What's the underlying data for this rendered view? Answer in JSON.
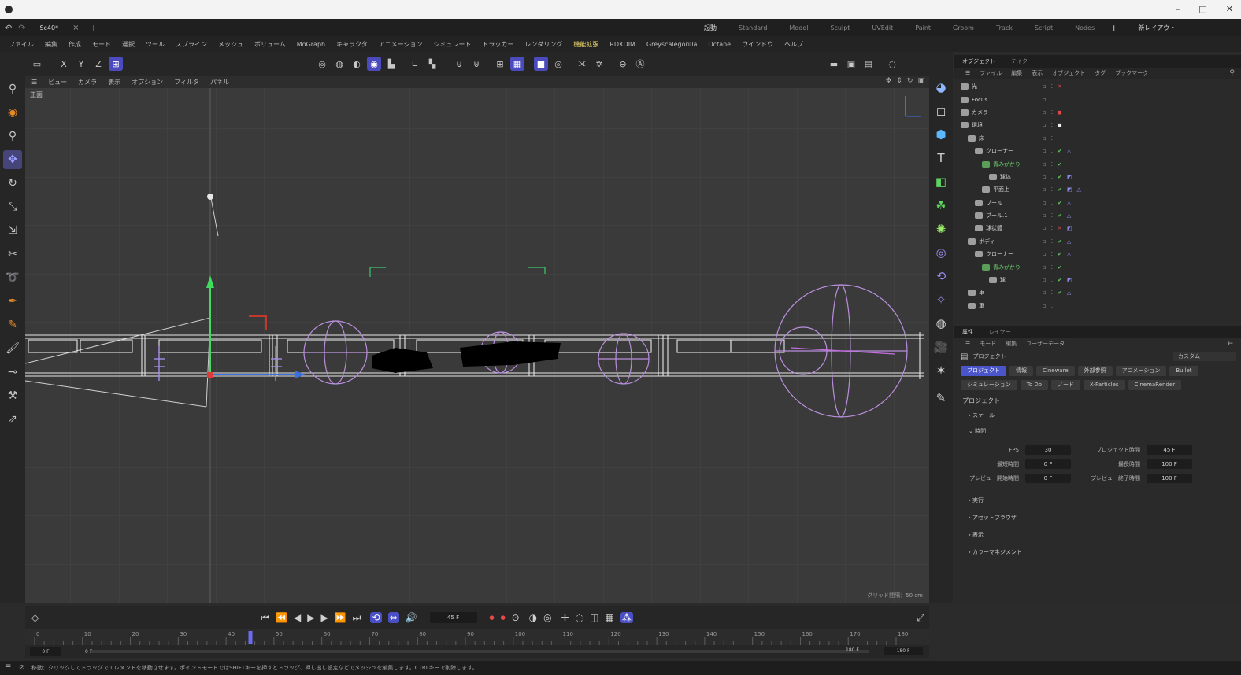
{
  "os": {
    "icon": "app-logo",
    "controls": [
      "–",
      "□",
      "✕"
    ]
  },
  "doc": {
    "undo": "↶",
    "redo": "↷",
    "title": "Sc40*",
    "close": "×",
    "add": "+"
  },
  "layouts": [
    "起動",
    "Standard",
    "Model",
    "Sculpt",
    "UVEdit",
    "Paint",
    "Groom",
    "Track",
    "Script",
    "Nodes"
  ],
  "layout_active": "起動",
  "layout_right": "新レイアウト",
  "menu": [
    "ファイル",
    "編集",
    "作成",
    "モード",
    "選択",
    "ツール",
    "スプライン",
    "メッシュ",
    "ボリューム",
    "MoGraph",
    "キャラクタ",
    "アニメーション",
    "シミュレート",
    "トラッカー",
    "レンダリング",
    "機能拡張",
    "RDXDIM",
    "Greyscalegorilla",
    "Octane",
    "ウインドウ",
    "ヘルプ"
  ],
  "menu_highlight": "機能拡張",
  "viewport": {
    "menu": [
      "ビュー",
      "カメラ",
      "表示",
      "オプション",
      "フィルタ",
      "パネル"
    ],
    "label": "正面",
    "grid_label": "グリッド間隔：50 cm"
  },
  "objects": {
    "tabs": [
      "オブジェクト",
      "テイク"
    ],
    "menu": [
      "ファイル",
      "編集",
      "表示",
      "オブジェクト",
      "タグ",
      "ブックマーク"
    ],
    "rows": [
      {
        "name": "光",
        "indent": 0,
        "color": "#d0d0d0",
        "state": "x"
      },
      {
        "name": "Focus",
        "indent": 0,
        "color": "#d0d0d0",
        "state": ""
      },
      {
        "name": "カメラ",
        "indent": 0,
        "color": "#d0d0d0",
        "state": "tag-red"
      },
      {
        "name": "環境",
        "indent": 0,
        "color": "#d0d0d0",
        "state": "tag-white"
      },
      {
        "name": "床",
        "indent": 1,
        "color": "#d0d0d0",
        "state": ""
      },
      {
        "name": "クローナー",
        "indent": 2,
        "color": "#d0d0d0",
        "state": "check"
      },
      {
        "name": "青みがかり",
        "indent": 3,
        "color": "#6fd06f",
        "state": "check"
      },
      {
        "name": "球体",
        "indent": 4,
        "color": "#d0d0d0",
        "state": "check-tag"
      },
      {
        "name": "平面上",
        "indent": 3,
        "color": "#d0d0d0",
        "state": "check-tag2"
      },
      {
        "name": "ブール",
        "indent": 2,
        "color": "#d0d0d0",
        "state": "check"
      },
      {
        "name": "ブール.1",
        "indent": 2,
        "color": "#d0d0d0",
        "state": "check"
      },
      {
        "name": "球状體",
        "indent": 2,
        "color": "#d0d0d0",
        "state": "x-tag"
      },
      {
        "name": "ボディ",
        "indent": 1,
        "color": "#d0d0d0",
        "state": "check"
      },
      {
        "name": "クローナー",
        "indent": 2,
        "color": "#d0d0d0",
        "state": "check"
      },
      {
        "name": "青みがかり",
        "indent": 3,
        "color": "#6fd06f",
        "state": "check"
      },
      {
        "name": "球",
        "indent": 4,
        "color": "#d0d0d0",
        "state": "check-tag"
      },
      {
        "name": "車",
        "indent": 1,
        "color": "#d0d0d0",
        "state": "check"
      },
      {
        "name": "車",
        "indent": 1,
        "color": "#d0d0d0",
        "state": ""
      }
    ]
  },
  "attributes": {
    "tabs": [
      "属性",
      "レイヤー"
    ],
    "menu": [
      "モード",
      "編集",
      "ユーザーデータ"
    ],
    "project_label": "プロジェクト",
    "custom": "カスタム",
    "chips_row1": [
      "プロジェクト",
      "情報",
      "Cineware",
      "外部参照",
      "アニメーション",
      "Bullet"
    ],
    "chips_row2": [
      "シミュレーション",
      "To Do",
      "ノード",
      "X-Particles",
      "CinemaRender"
    ],
    "chip_active": "プロジェクト",
    "section_title": "プロジェクト",
    "scale": "スケール",
    "timing": "時間",
    "fields": [
      {
        "label": "FPS",
        "value": "30",
        "label2": "プロジェクト時間",
        "value2": "45 F"
      },
      {
        "label": "最短時間",
        "value": "0 F",
        "label2": "最長時間",
        "value2": "100 F"
      },
      {
        "label": "プレビュー開始時間",
        "value": "0 F",
        "label2": "プレビュー終了時間",
        "value2": "100 F"
      }
    ],
    "sections": [
      "実行",
      "アセットブラウザ",
      "表示",
      "カラーマネジメント"
    ]
  },
  "timeline": {
    "current_frame": "45 F",
    "ticks": [
      0,
      10,
      20,
      30,
      40,
      50,
      60,
      70,
      80,
      90,
      100,
      110,
      120,
      130,
      140,
      150,
      160,
      170,
      180
    ],
    "range_start": "0 F",
    "range_start2": "0 F",
    "range_end": "180 F",
    "range_end2": "180 F"
  },
  "status": "移動：クリックしてドラッグでエレメントを移動させます。ポイントモードではSHIFTキーを押すとドラッグ、押し出し設定などでメッシュを編集します。CTRLキーで削除します。"
}
